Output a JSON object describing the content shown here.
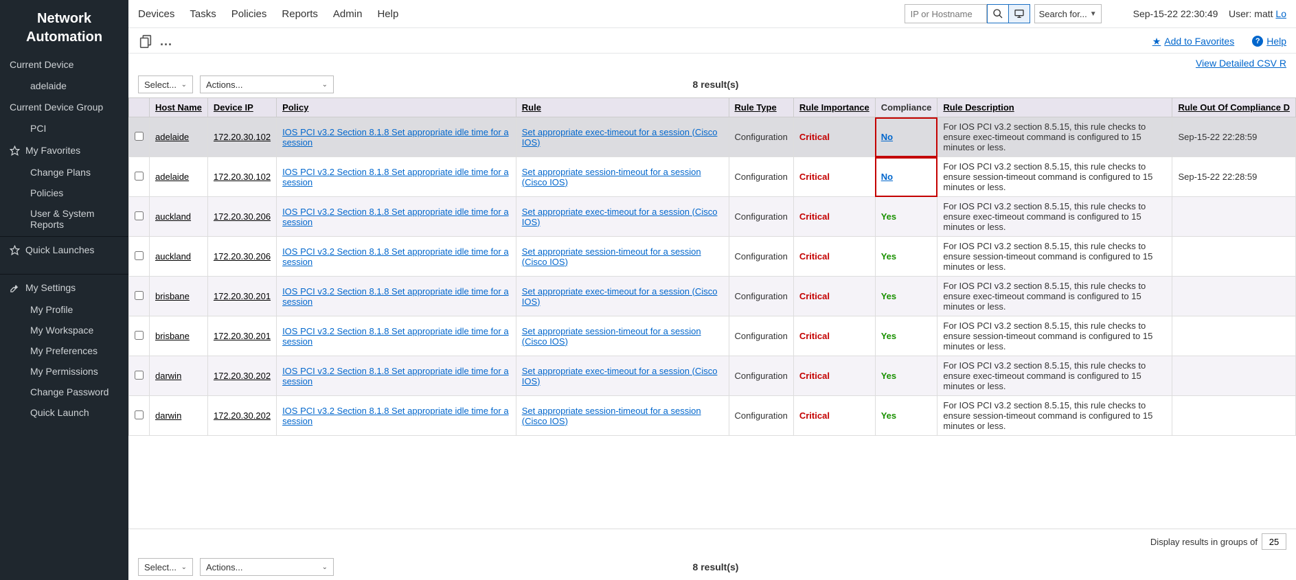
{
  "sidebar": {
    "title_line1": "Network",
    "title_line2": "Automation",
    "current_device_label": "Current Device",
    "current_device": "adelaide",
    "current_group_label": "Current Device Group",
    "current_group": "PCI",
    "favorites_label": "My Favorites",
    "favorites": [
      "Change Plans",
      "Policies",
      "User & System Reports"
    ],
    "quick_launches_label": "Quick Launches",
    "settings_label": "My Settings",
    "settings_items": [
      "My Profile",
      "My Workspace",
      "My Preferences",
      "My Permissions",
      "Change Password",
      "Quick Launch"
    ]
  },
  "topnav": {
    "links": [
      "Devices",
      "Tasks",
      "Policies",
      "Reports",
      "Admin",
      "Help"
    ],
    "search_placeholder": "IP or Hostname",
    "search_for": "Search for...",
    "timestamp": "Sep-15-22 22:30:49",
    "user_label": "User:",
    "user_name": "matt",
    "logout": "Lo"
  },
  "subbar": {
    "dots": "...",
    "add_favorites": "Add to Favorites",
    "help": "Help",
    "csv_link": "View Detailed CSV R"
  },
  "controls": {
    "select_label": "Select...",
    "actions_label": "Actions...",
    "results": "8 result(s)"
  },
  "pager": {
    "label": "Display results in groups of",
    "value": "25"
  },
  "table": {
    "headers": [
      "Host Name",
      "Device IP",
      "Policy",
      "Rule",
      "Rule Type",
      "Rule Importance",
      "Compliance",
      "Rule Description",
      "Rule Out Of Compliance D"
    ],
    "rows": [
      {
        "host": "adelaide",
        "ip": "172.20.30.102",
        "policy": "IOS PCI v3.2 Section 8.1.8 Set appropriate idle time for a session",
        "rule": "Set appropriate exec-timeout for a session (Cisco IOS)",
        "type": "Configuration",
        "imp": "Critical",
        "comp": "No",
        "desc": "For IOS PCI v3.2 section 8.5.15, this rule checks to ensure exec-timeout command is configured to 15 minutes or less.",
        "out": "Sep-15-22 22:28:59",
        "hl": true,
        "box": true
      },
      {
        "host": "adelaide",
        "ip": "172.20.30.102",
        "policy": "IOS PCI v3.2 Section 8.1.8 Set appropriate idle time for a session",
        "rule": "Set appropriate session-timeout for a session (Cisco IOS)",
        "type": "Configuration",
        "imp": "Critical",
        "comp": "No",
        "desc": "For IOS PCI v3.2 section 8.5.15, this rule checks to ensure session-timeout command is configured to 15 minutes or less.",
        "out": "Sep-15-22 22:28:59",
        "hl": false,
        "box": true
      },
      {
        "host": "auckland",
        "ip": "172.20.30.206",
        "policy": "IOS PCI v3.2 Section 8.1.8 Set appropriate idle time for a session",
        "rule": "Set appropriate exec-timeout for a session (Cisco IOS)",
        "type": "Configuration",
        "imp": "Critical",
        "comp": "Yes",
        "desc": "For IOS PCI v3.2 section 8.5.15, this rule checks to ensure exec-timeout command is configured to 15 minutes or less.",
        "out": "",
        "hl": false,
        "box": false
      },
      {
        "host": "auckland",
        "ip": "172.20.30.206",
        "policy": "IOS PCI v3.2 Section 8.1.8 Set appropriate idle time for a session",
        "rule": "Set appropriate session-timeout for a session (Cisco IOS)",
        "type": "Configuration",
        "imp": "Critical",
        "comp": "Yes",
        "desc": "For IOS PCI v3.2 section 8.5.15, this rule checks to ensure session-timeout command is configured to 15 minutes or less.",
        "out": "",
        "hl": false,
        "box": false
      },
      {
        "host": "brisbane",
        "ip": "172.20.30.201",
        "policy": "IOS PCI v3.2 Section 8.1.8 Set appropriate idle time for a session",
        "rule": "Set appropriate exec-timeout for a session (Cisco IOS)",
        "type": "Configuration",
        "imp": "Critical",
        "comp": "Yes",
        "desc": "For IOS PCI v3.2 section 8.5.15, this rule checks to ensure exec-timeout command is configured to 15 minutes or less.",
        "out": "",
        "hl": false,
        "box": false
      },
      {
        "host": "brisbane",
        "ip": "172.20.30.201",
        "policy": "IOS PCI v3.2 Section 8.1.8 Set appropriate idle time for a session",
        "rule": "Set appropriate session-timeout for a session (Cisco IOS)",
        "type": "Configuration",
        "imp": "Critical",
        "comp": "Yes",
        "desc": "For IOS PCI v3.2 section 8.5.15, this rule checks to ensure session-timeout command is configured to 15 minutes or less.",
        "out": "",
        "hl": false,
        "box": false
      },
      {
        "host": "darwin",
        "ip": "172.20.30.202",
        "policy": "IOS PCI v3.2 Section 8.1.8 Set appropriate idle time for a session",
        "rule": "Set appropriate exec-timeout for a session (Cisco IOS)",
        "type": "Configuration",
        "imp": "Critical",
        "comp": "Yes",
        "desc": "For IOS PCI v3.2 section 8.5.15, this rule checks to ensure exec-timeout command is configured to 15 minutes or less.",
        "out": "",
        "hl": false,
        "box": false
      },
      {
        "host": "darwin",
        "ip": "172.20.30.202",
        "policy": "IOS PCI v3.2 Section 8.1.8 Set appropriate idle time for a session",
        "rule": "Set appropriate session-timeout for a session (Cisco IOS)",
        "type": "Configuration",
        "imp": "Critical",
        "comp": "Yes",
        "desc": "For IOS PCI v3.2 section 8.5.15, this rule checks to ensure session-timeout command is configured to 15 minutes or less.",
        "out": "",
        "hl": false,
        "box": false
      }
    ]
  }
}
